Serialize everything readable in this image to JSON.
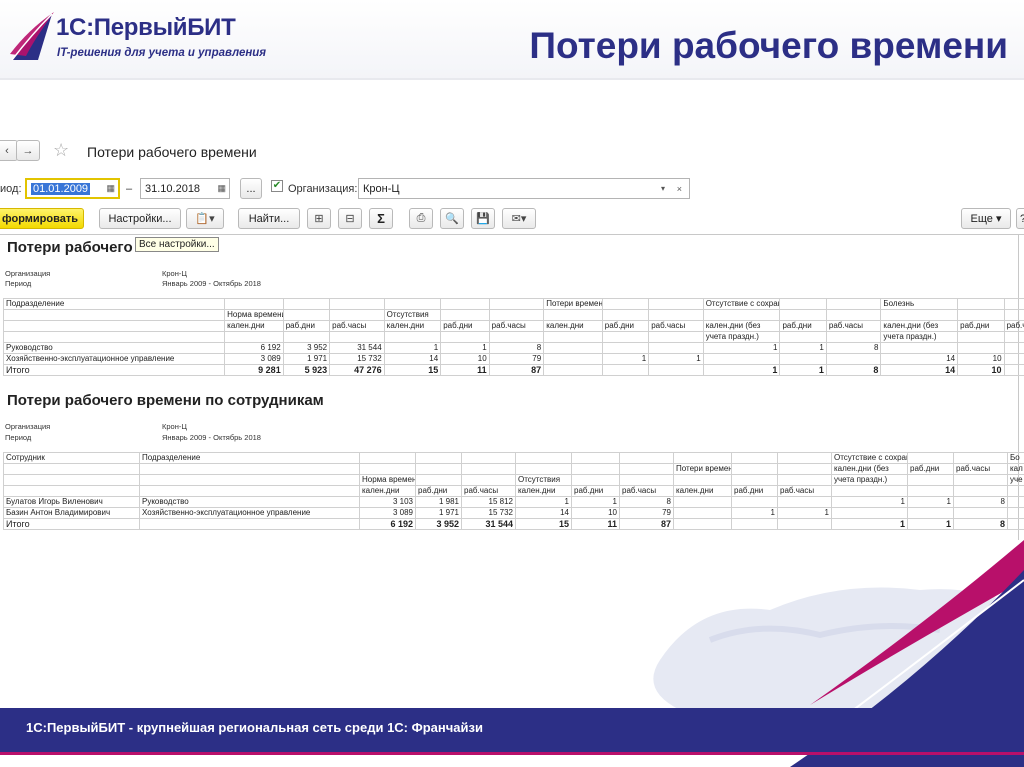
{
  "brand": {
    "logo_title": "1С:ПервыйБИТ",
    "logo_subtitle": "IT-решения для учета и управления",
    "slide_title": "Потери рабочего времени",
    "footer": "1С:ПервыйБИТ - крупнейшая региональная сеть среди 1С: Франчайзи",
    "colors": {
      "navy": "#2c2f86",
      "pink": "#b8106a"
    }
  },
  "toolbar": {
    "back_icon": "arrow-left-icon",
    "forward_icon": "arrow-right-icon",
    "favorite_icon": "star-icon",
    "form_title": "Потери рабочего времени",
    "period_label": "иод:",
    "date_from": "01.01.2009",
    "dash": "–",
    "date_to": "31.10.2018",
    "ellipsis": "...",
    "org_label": "Организация:",
    "org_value": "Крон-Ц",
    "generate": "формировать",
    "settings": "Настройки...",
    "find": "Найти...",
    "sum_icon": "Σ",
    "more": "Еще",
    "tooltip": "Все настройки..."
  },
  "report1": {
    "title": "Потери рабочего",
    "meta": [
      {
        "k": "Организация",
        "v": "Крон-Ц"
      },
      {
        "k": "Период",
        "v": "Январь 2009 - Октябрь 2018"
      }
    ],
    "head1": [
      "Подразделение",
      "",
      "",
      "",
      "",
      "",
      "",
      "Потери времени (%)",
      "",
      "",
      "Отсутствие с сохранением оплаты",
      "",
      "",
      "Болезнь",
      "",
      ""
    ],
    "head2": [
      "",
      "Норма времени",
      "",
      "",
      "Отсутствия",
      "",
      "",
      "",
      "",
      "",
      "",
      "",
      "",
      "",
      "",
      ""
    ],
    "head3": [
      "",
      "кален.дни",
      "раб.дни",
      "раб.часы",
      "кален.дни",
      "раб.дни",
      "раб.часы",
      "кален.дни",
      "раб.дни",
      "раб.часы",
      "кален.дни (без",
      "раб.дни",
      "раб.часы",
      "кален.дни (без",
      "раб.дни",
      "раб.ч"
    ],
    "head4": [
      "",
      "",
      "",
      "",
      "",
      "",
      "",
      "",
      "",
      "",
      "учета праздн.)",
      "",
      "",
      "учета праздн.)",
      "",
      ""
    ],
    "rows": [
      [
        "Руководство",
        "6 192",
        "3 952",
        "31 544",
        "1",
        "1",
        "8",
        "",
        "",
        "",
        "1",
        "1",
        "8",
        "",
        "",
        ""
      ],
      [
        "Хозяйственно-эксплуатационное управление",
        "3 089",
        "1 971",
        "15 732",
        "14",
        "10",
        "79",
        "",
        "1",
        "1",
        "",
        "",
        "",
        "14",
        "10",
        ""
      ]
    ],
    "total": [
      "Итого",
      "9 281",
      "5 923",
      "47 276",
      "15",
      "11",
      "87",
      "",
      "",
      "",
      "1",
      "1",
      "8",
      "14",
      "10",
      ""
    ]
  },
  "report2": {
    "title": "Потери рабочего времени по сотрудникам",
    "meta": [
      {
        "k": "Организация",
        "v": "Крон-Ц"
      },
      {
        "k": "Период",
        "v": "Январь 2009 - Октябрь 2018"
      }
    ],
    "head1": [
      "Сотрудник",
      "Подразделение",
      "",
      "",
      "",
      "",
      "",
      "",
      "",
      "",
      "",
      "Отсутствие с сохранением оплаты",
      "",
      "",
      "Бо"
    ],
    "head2": [
      "",
      "",
      "",
      "",
      "",
      "",
      "",
      "",
      "Потери времени (%)",
      "",
      "",
      "кален.дни (без",
      "раб.дни",
      "раб.часы",
      "кал"
    ],
    "head3": [
      "",
      "",
      "Норма времени",
      "",
      "",
      "Отсутствия",
      "",
      "",
      "",
      "",
      "",
      "учета праздн.)",
      "",
      "",
      "уче"
    ],
    "head4": [
      "",
      "",
      "кален.дни",
      "раб.дни",
      "раб.часы",
      "кален.дни",
      "раб.дни",
      "раб.часы",
      "кален.дни",
      "раб.дни",
      "раб.часы",
      "",
      "",
      "",
      ""
    ],
    "rows": [
      [
        "Булатов Игорь Виленович",
        "Руководство",
        "3 103",
        "1 981",
        "15 812",
        "1",
        "1",
        "8",
        "",
        "",
        "",
        "1",
        "1",
        "8",
        ""
      ],
      [
        "Базин Антон Владимирович",
        "Хозяйственно-эксплуатационное управление",
        "3 089",
        "1 971",
        "15 732",
        "14",
        "10",
        "79",
        "",
        "1",
        "1",
        "",
        "",
        "",
        ""
      ]
    ],
    "total": [
      "Итого",
      "",
      "6 192",
      "3 952",
      "31 544",
      "15",
      "11",
      "87",
      "",
      "",
      "",
      "1",
      "1",
      "8",
      ""
    ]
  }
}
